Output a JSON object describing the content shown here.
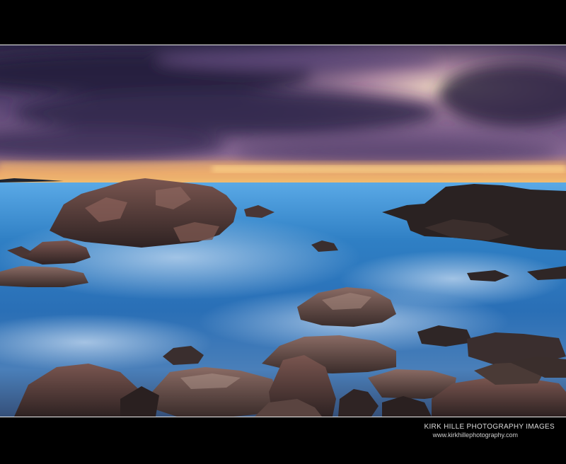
{
  "caption": {
    "title": "KIRK HILLE PHOTOGRAPHY IMAGES",
    "url": "www.kirkhillephotography.com"
  },
  "palette": {
    "frame": "#000000",
    "sky_dark": "#2b2342",
    "sky_purple": "#6a4f82",
    "sunset_glow": "#ffb347",
    "sea_blue": "#2f7fc4",
    "sea_mist": "#9fc3e6",
    "rock_dark": "#2a2020",
    "rock_brown": "#5a3e38"
  }
}
